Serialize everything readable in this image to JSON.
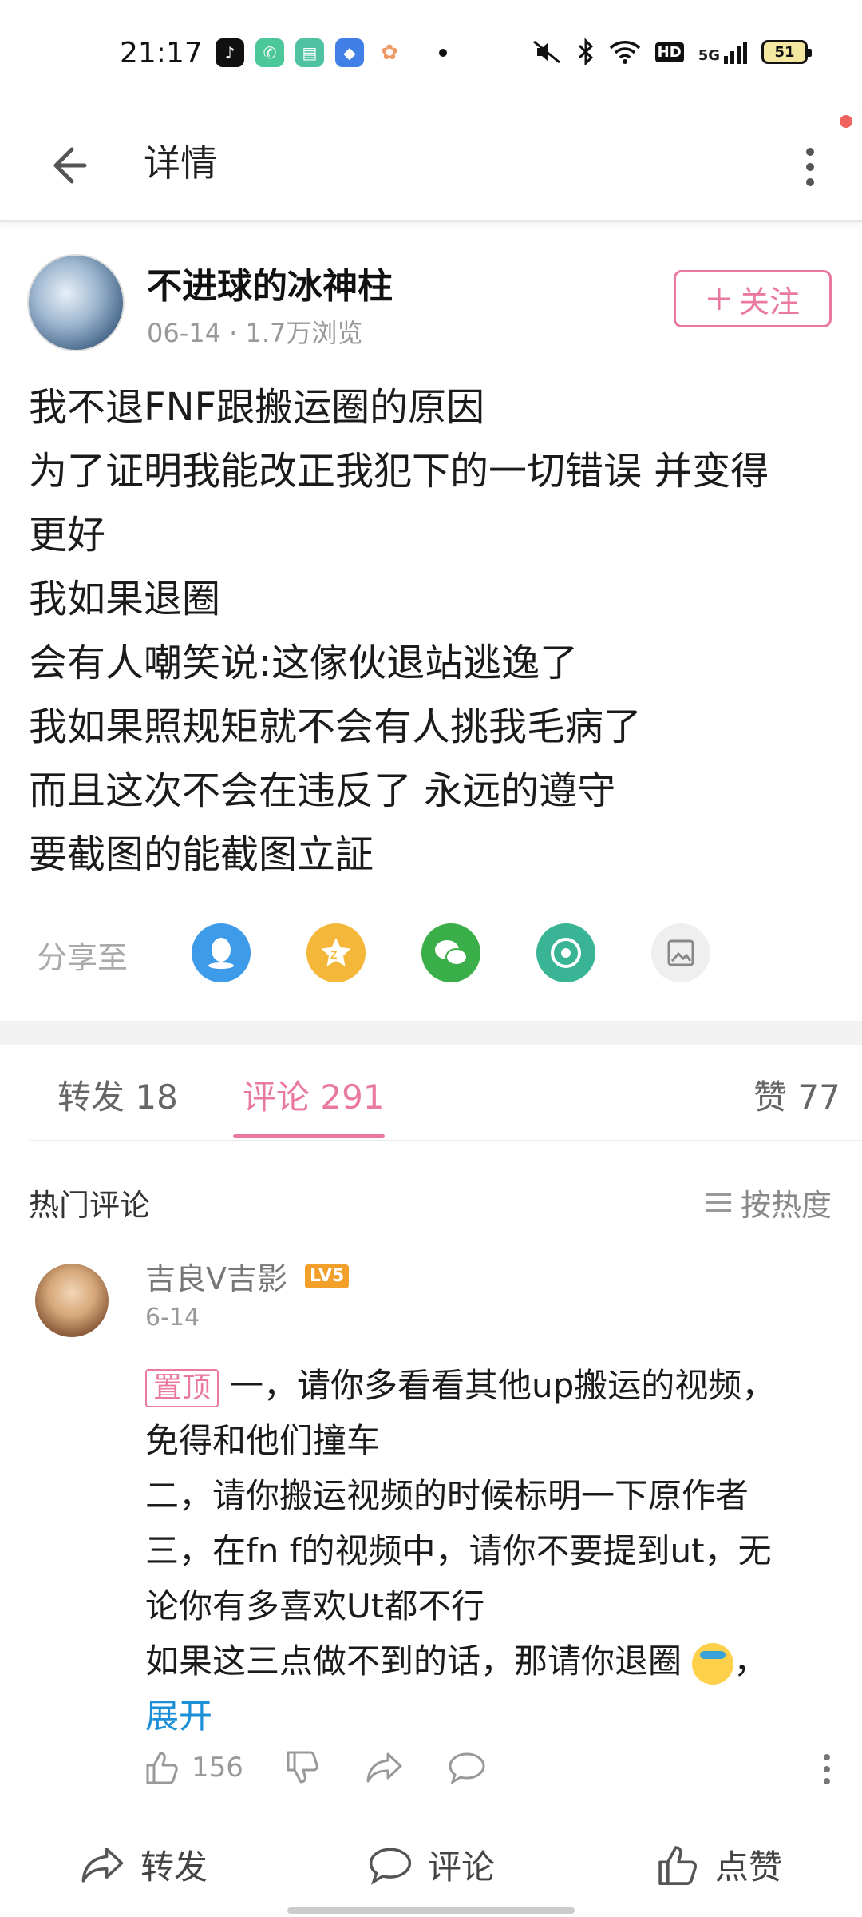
{
  "status_bar": {
    "time": "21:17",
    "network": "5G",
    "hd": "HD",
    "battery": "51",
    "icons": [
      "tiktok-icon",
      "phone-icon",
      "app-icon",
      "cloud-icon",
      "photos-icon",
      "mute-icon",
      "bluetooth-icon",
      "wifi-icon",
      "signal-icon"
    ]
  },
  "header": {
    "title": "详情",
    "back_icon": "arrow-left-icon",
    "more_icon": "more-vertical-icon"
  },
  "post": {
    "author": "不进球的冰神柱",
    "meta": "06-14 · 1.7万浏览",
    "follow_label": "关注",
    "lines": [
      "我不退FNF跟搬运圈的原因",
      "为了证明我能改正我犯下的一切错误 并变得",
      "更好",
      "我如果退圈",
      "会有人嘲笑说:这傢伙退站逃逸了",
      "我如果照规矩就不会有人挑我毛病了",
      "而且这次不会在违反了 永远的遵守",
      "要截图的能截图立証"
    ]
  },
  "share": {
    "label": "分享至",
    "targets": [
      {
        "name": "qq-icon",
        "color": "#3d9be9"
      },
      {
        "name": "qzone-icon",
        "color": "#f4b73a"
      },
      {
        "name": "wechat-icon",
        "color": "#3aae48"
      },
      {
        "name": "moments-icon",
        "color": "#39b595"
      },
      {
        "name": "save-image-icon",
        "color": "#efefef"
      }
    ]
  },
  "tabs": {
    "repost": "转发 18",
    "comments": "评论 291",
    "likes": "赞 77"
  },
  "comments_section": {
    "title": "热门评论",
    "sort_label": "按热度"
  },
  "comment": {
    "user": "吉良V吉影",
    "level": "LV5",
    "date": "6-14",
    "pin": "置顶",
    "line1": "一，请你多看看其他up搬运的视频，",
    "line2": "免得和他们撞车",
    "line3": "二，请你搬运视频的时候标明一下原作者",
    "line4": "三，在fn f的视频中，请你不要提到ut，无",
    "line5": "论你有多喜欢Ut都不行",
    "line6": "如果这三点做不到的话，那请你退圈",
    "line6_tail": "，",
    "expand": "展开",
    "like_count": "156"
  },
  "bottom_bar": {
    "repost": "转发",
    "comment": "评论",
    "like": "点赞"
  },
  "colors": {
    "accent": "#e9799e",
    "link": "#1d8fd6"
  }
}
